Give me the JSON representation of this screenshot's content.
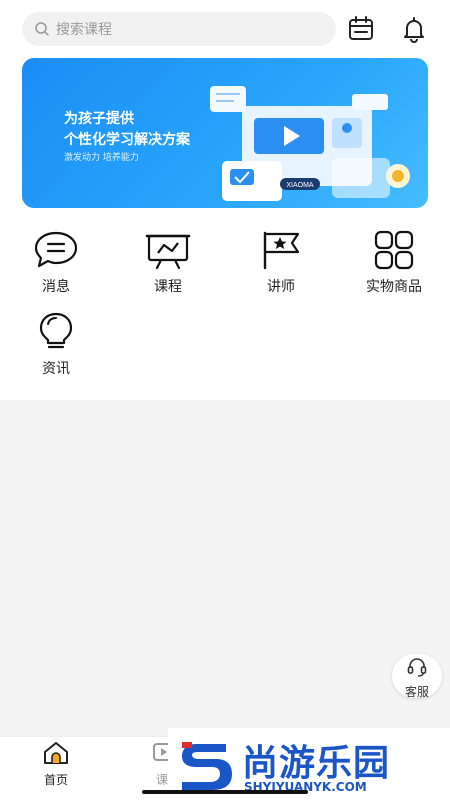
{
  "search": {
    "placeholder": "搜索课程"
  },
  "header_icons": [
    "calendar-icon",
    "bell-icon"
  ],
  "banner": {
    "line1": "为孩子提供",
    "line2": "个性化学习解决方案",
    "line3": "激发动力 培养能力",
    "tag": "XIAOMA"
  },
  "grid": [
    {
      "label": "消息",
      "icon": "message-icon"
    },
    {
      "label": "课程",
      "icon": "course-icon"
    },
    {
      "label": "讲师",
      "icon": "lecturer-icon"
    },
    {
      "label": "实物商品",
      "icon": "grid-icon"
    },
    {
      "label": "资讯",
      "icon": "bulb-icon"
    }
  ],
  "service": {
    "label": "客服"
  },
  "tabs": [
    {
      "label": "首页",
      "icon": "home-icon"
    },
    {
      "label": "课",
      "icon": "course-tab-icon"
    }
  ],
  "watermark": {
    "title": "尚游乐园",
    "url": "SHYIYUANYK.COM"
  },
  "colors": {
    "accent": "#1a8df6",
    "watermark": "#1a56c8"
  }
}
